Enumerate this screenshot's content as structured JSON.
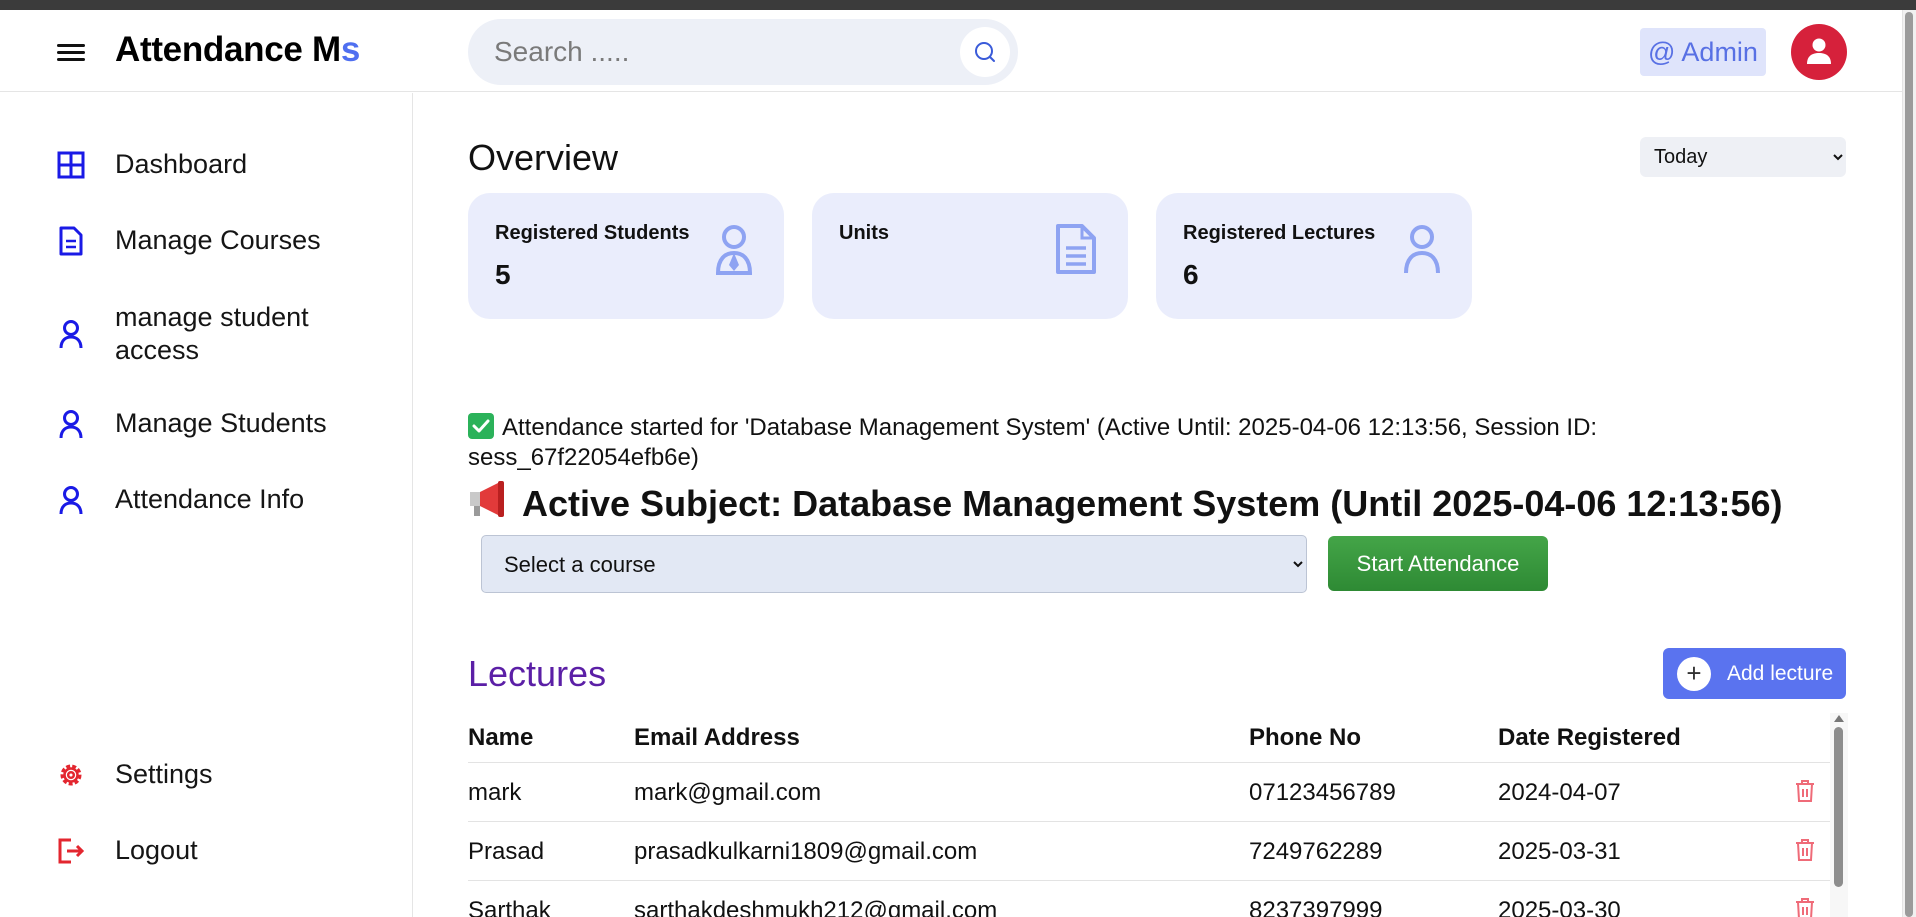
{
  "header": {
    "brand_main": "Attendance M",
    "brand_accent": "s",
    "search_placeholder": "Search .....",
    "admin_label": "@ Admin"
  },
  "sidebar": {
    "items": [
      {
        "label": "Dashboard",
        "icon": "grid-icon"
      },
      {
        "label": "Manage Courses",
        "icon": "document-icon"
      },
      {
        "label": "manage student access",
        "icon": "user-icon"
      },
      {
        "label": "Manage Students",
        "icon": "user-icon"
      },
      {
        "label": "Attendance Info",
        "icon": "user-icon"
      }
    ],
    "bottom_items": [
      {
        "label": "Settings",
        "icon": "gear-icon"
      },
      {
        "label": "Logout",
        "icon": "logout-icon"
      }
    ]
  },
  "overview": {
    "title": "Overview",
    "range_selected": "Today",
    "cards": [
      {
        "title": "Registered Students",
        "value": "5",
        "icon": "student-icon"
      },
      {
        "title": "Units",
        "value": "",
        "icon": "document-icon"
      },
      {
        "title": "Registered Lectures",
        "value": "6",
        "icon": "user-icon"
      }
    ]
  },
  "attendance": {
    "notice": "Attendance started for 'Database Management System' (Active Until: 2025-04-06 12:13:56, Session ID: sess_67f22054efb6e)",
    "active_subject": "Active Subject: Database Management System (Until 2025-04-06 12:13:56)",
    "course_select_placeholder": "Select a course",
    "start_button": "Start Attendance"
  },
  "lectures": {
    "title": "Lectures",
    "add_button": "Add lecture",
    "columns": [
      "Name",
      "Email Address",
      "Phone No",
      "Date Registered"
    ],
    "rows": [
      {
        "name": "mark",
        "email": "mark@gmail.com",
        "phone": "07123456789",
        "date": "2024-04-07"
      },
      {
        "name": "Prasad",
        "email": "prasadkulkarni1809@gmail.com",
        "phone": "7249762289",
        "date": "2025-03-31"
      },
      {
        "name": "Sarthak",
        "email": "sarthakdeshmukh212@gmail.com",
        "phone": "8237397999",
        "date": "2025-03-30"
      }
    ]
  },
  "colors": {
    "accent_blue": "#4f6ff0",
    "sidebar_icon_blue": "#1a1ae6",
    "danger_red": "#e3262f",
    "lectures_purple": "#5b1fa6",
    "start_green": "#3c9a40"
  }
}
